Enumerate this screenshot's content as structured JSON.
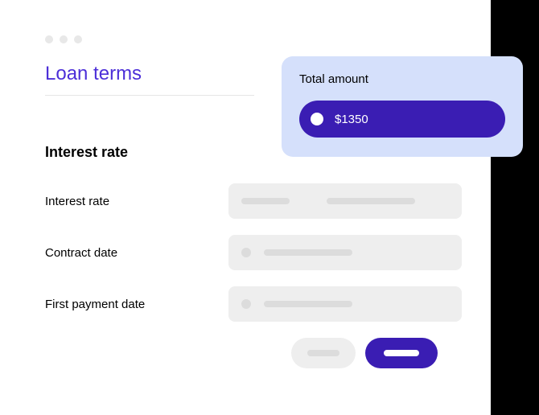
{
  "window": {
    "title": "Loan terms"
  },
  "section": {
    "heading": "Interest rate",
    "rows": [
      {
        "label": "Interest rate"
      },
      {
        "label": "Contract date"
      },
      {
        "label": "First payment date"
      }
    ]
  },
  "overlay": {
    "label": "Total amount",
    "value": "$1350"
  }
}
